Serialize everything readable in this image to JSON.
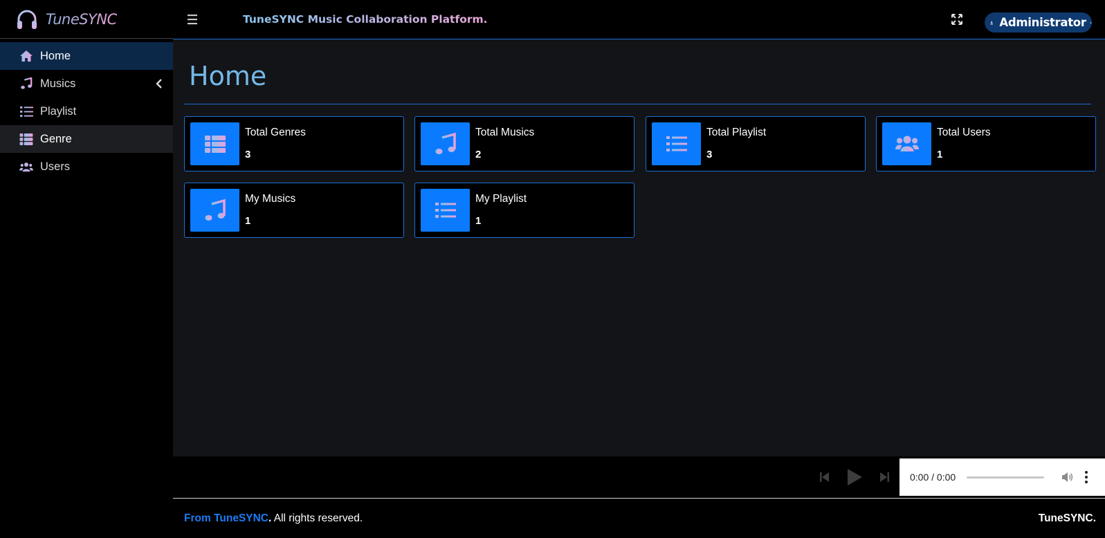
{
  "brand": {
    "name": "TuneSYNC",
    "icon": "headphones-icon"
  },
  "sidebar": {
    "items": [
      {
        "label": "Home",
        "icon": "home-icon"
      },
      {
        "label": "Musics",
        "icon": "music-note-icon"
      },
      {
        "label": "Playlist",
        "icon": "list-icon"
      },
      {
        "label": "Genre",
        "icon": "table-list-icon"
      },
      {
        "label": "Users",
        "icon": "users-icon"
      }
    ]
  },
  "header": {
    "title": "TuneSYNC Music Collaboration Platform.",
    "user": "Administrator"
  },
  "main": {
    "title": "Home",
    "cards": [
      {
        "label": "Total Genres",
        "value": "3",
        "icon": "table-list-icon"
      },
      {
        "label": "Total Musics",
        "value": "2",
        "icon": "music-note-icon"
      },
      {
        "label": "Total Playlist",
        "value": "3",
        "icon": "list-icon"
      },
      {
        "label": "Total Users",
        "value": "1",
        "icon": "users-icon"
      },
      {
        "label": "My Musics",
        "value": "1",
        "icon": "music-note-icon"
      },
      {
        "label": "My Playlist",
        "value": "1",
        "icon": "list-icon"
      }
    ]
  },
  "player": {
    "time": "0:00 / 0:00"
  },
  "footer": {
    "prefix": "From ",
    "link": "TuneSYNC",
    "dot": ".",
    "rest": " All rights reserved.",
    "right": "TuneSYNC."
  },
  "colors": {
    "accent": "#0a7bff",
    "border": "#1e6fd9",
    "title": "#74b8e8",
    "sidebar_active": "#0b2848",
    "icon_gradient_start": "#8fc2ec",
    "icon_gradient_end": "#e7a3d6"
  }
}
